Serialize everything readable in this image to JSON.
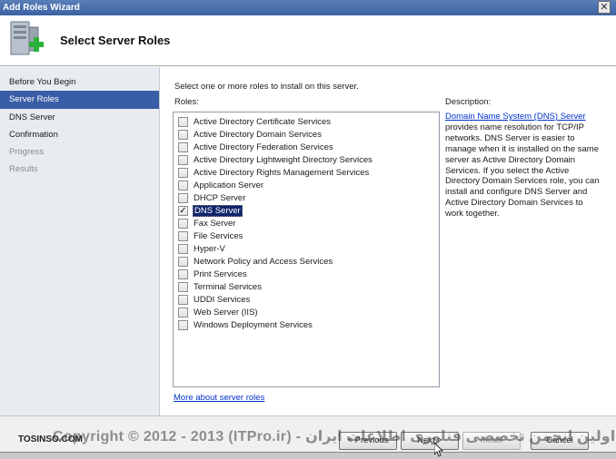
{
  "window": {
    "title": "Add Roles Wizard",
    "close_glyph": "✕"
  },
  "header": {
    "title": "Select Server Roles",
    "icon": "server-roles-icon"
  },
  "sidebar": {
    "items": [
      {
        "label": "Before You Begin",
        "state": "normal"
      },
      {
        "label": "Server Roles",
        "state": "selected"
      },
      {
        "label": "DNS Server",
        "state": "normal"
      },
      {
        "label": "Confirmation",
        "state": "normal"
      },
      {
        "label": "Progress",
        "state": "disabled"
      },
      {
        "label": "Results",
        "state": "disabled"
      }
    ]
  },
  "main": {
    "instruction": "Select one or more roles to install on this server.",
    "roles_label": "Roles:",
    "roles": [
      {
        "label": "Active Directory Certificate Services",
        "checked": false
      },
      {
        "label": "Active Directory Domain Services",
        "checked": false
      },
      {
        "label": "Active Directory Federation Services",
        "checked": false
      },
      {
        "label": "Active Directory Lightweight Directory Services",
        "checked": false
      },
      {
        "label": "Active Directory Rights Management Services",
        "checked": false
      },
      {
        "label": "Application Server",
        "checked": false
      },
      {
        "label": "DHCP Server",
        "checked": false
      },
      {
        "label": "DNS Server",
        "checked": true,
        "selected": true
      },
      {
        "label": "Fax Server",
        "checked": false
      },
      {
        "label": "File Services",
        "checked": false
      },
      {
        "label": "Hyper-V",
        "checked": false
      },
      {
        "label": "Network Policy and Access Services",
        "checked": false
      },
      {
        "label": "Print Services",
        "checked": false
      },
      {
        "label": "Terminal Services",
        "checked": false
      },
      {
        "label": "UDDI Services",
        "checked": false
      },
      {
        "label": "Web Server (IIS)",
        "checked": false
      },
      {
        "label": "Windows Deployment Services",
        "checked": false
      }
    ],
    "more_link": "More about server roles",
    "description_label": "Description:",
    "description_link": "Domain Name System (DNS) Server",
    "description_text": " provides name resolution for TCP/IP networks. DNS Server is easier to manage when it is installed on the same server as Active Directory Domain Services. If you select the Active Directory Domain Services role, you can install and configure DNS Server and Active Directory Domain Services to work together."
  },
  "footer": {
    "previous": "< Previous",
    "next": "Next >",
    "install": "Install",
    "cancel": "Cancel"
  },
  "overlay": {
    "watermark": "Copyright © 2012 - 2013 (ITPro.ir) - اولین انجمن تخصصی فناوری اطلاعات ایران",
    "watermark_site": "TOSINSO.COM"
  }
}
